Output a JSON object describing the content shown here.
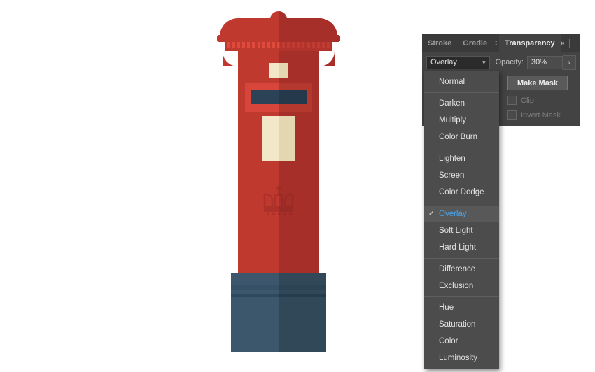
{
  "app": {
    "canvas_background": "#ffffff"
  },
  "illustration": {
    "name": "british-pillar-postbox",
    "colors": {
      "red_light": "#c0392f",
      "red_dark": "#a62f2a",
      "red_bezel": "#d8453a",
      "cream": "#f2e8c9",
      "cream_shadow": "#e3d6b0",
      "navy": "#3c566b",
      "navy_dark": "#314859",
      "slot": "#2b4257"
    }
  },
  "panel": {
    "tabs": [
      {
        "label": "Stroke",
        "active": false
      },
      {
        "label": "Gradie",
        "active": false
      },
      {
        "label": "Transparency",
        "active": true
      }
    ],
    "tab_arrows_icon": "updown-arrows-icon",
    "expand_icon": "double-chevron-right-icon",
    "menu_icon": "hamburger-menu-icon",
    "blend_mode": {
      "value": "Overlay",
      "chevron": "chevron-down-icon"
    },
    "opacity": {
      "label": "Opacity:",
      "value": "30%",
      "stepper_icon": "chevron-right-icon"
    },
    "thumbnail_icon": "no-artwork-icon",
    "make_mask_label": "Make Mask",
    "checkboxes": [
      {
        "label": "Clip",
        "checked": false,
        "enabled": false
      },
      {
        "label": "Invert Mask",
        "checked": false,
        "enabled": false
      }
    ]
  },
  "dropdown": {
    "selected": "Overlay",
    "check_glyph": "✓",
    "groups": [
      {
        "items": [
          "Normal"
        ]
      },
      {
        "items": [
          "Darken",
          "Multiply",
          "Color Burn"
        ]
      },
      {
        "items": [
          "Lighten",
          "Screen",
          "Color Dodge"
        ]
      },
      {
        "items": [
          "Overlay",
          "Soft Light",
          "Hard Light"
        ]
      },
      {
        "items": [
          "Difference",
          "Exclusion"
        ]
      },
      {
        "items": [
          "Hue",
          "Saturation",
          "Color",
          "Luminosity"
        ]
      }
    ],
    "highlight_color": "#4aa3e8"
  }
}
